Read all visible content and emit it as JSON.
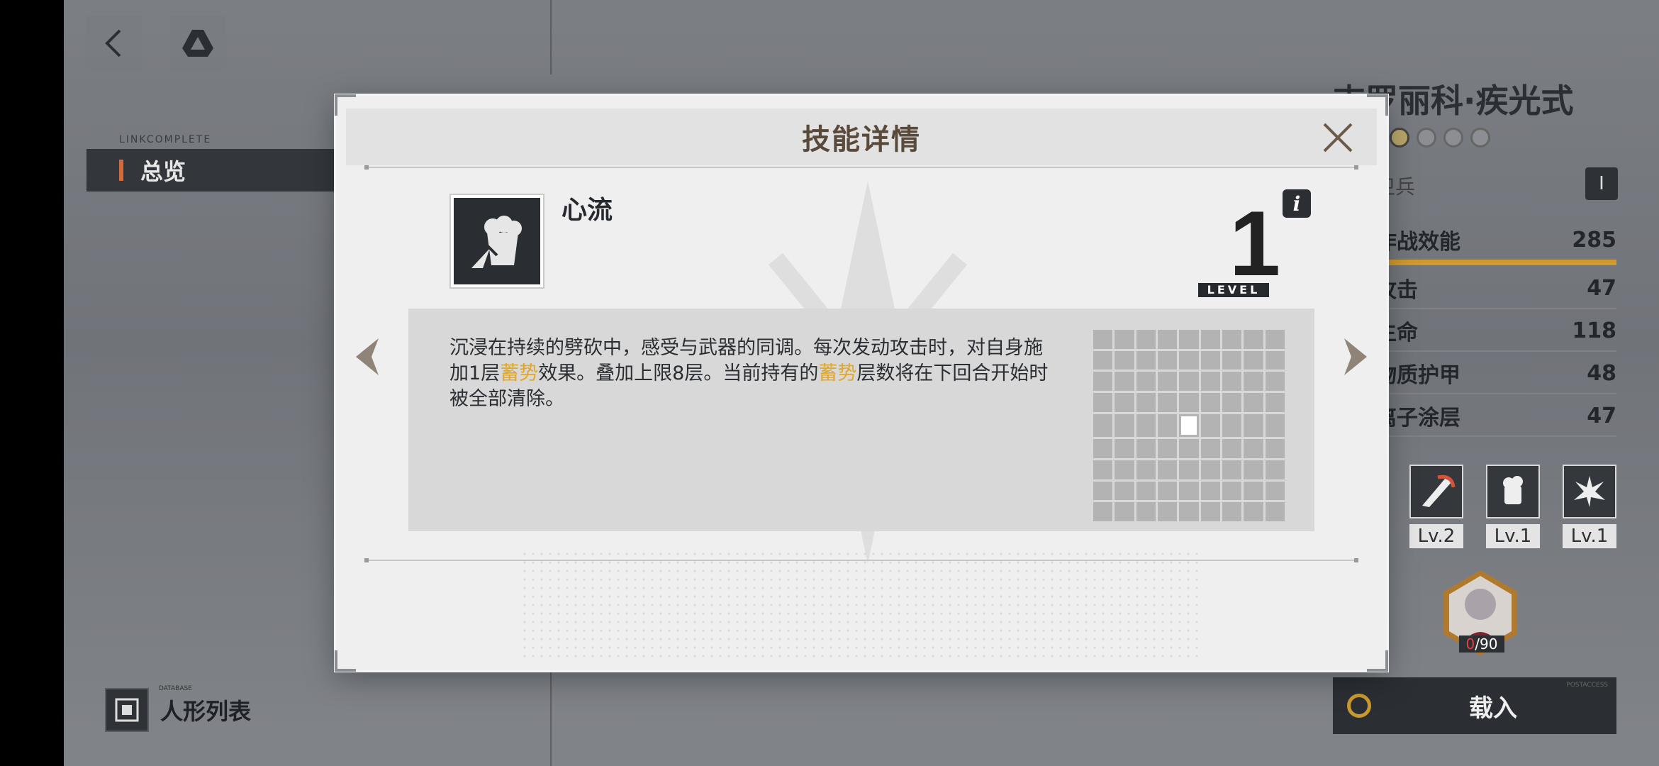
{
  "top_bar": {
    "back_icon": "chevron-left-icon",
    "drive_icon": "triangle-logo-icon"
  },
  "left_panel": {
    "link_label": "LINKCOMPLETE",
    "overview_label": "总览"
  },
  "bottom_left": {
    "dolls_list_label": "人形列表",
    "dolls_list_sub": "DATABASE"
  },
  "character": {
    "name": "吉罗丽科·疾光式",
    "role": "卫兵",
    "role_badge": "I",
    "stats": [
      {
        "label": "作战效能",
        "value": "285"
      },
      {
        "label": "攻击",
        "value": "47"
      },
      {
        "label": "生命",
        "value": "118"
      },
      {
        "label": "物质护甲",
        "value": "48"
      },
      {
        "label": "离子涂层",
        "value": "47"
      }
    ],
    "skills": [
      {
        "level": "Lv.2",
        "icon": "blade-strike-icon"
      },
      {
        "level": "Lv.1",
        "icon": "fist-icon"
      },
      {
        "level": "Lv.1",
        "icon": "burst-icon"
      }
    ],
    "avatar_count": "0",
    "avatar_max": "/90",
    "load_label": "载入",
    "load_sub": "POSTACCESS"
  },
  "modal": {
    "title": "技能详情",
    "skill_name": "心流",
    "level": "1",
    "level_label": "LEVEL",
    "info_label": "i",
    "desc_part1": "沉浸在持续的劈砍中，感受与武器的同调。每次发动攻击时，对自身施加1层",
    "desc_hl1": "蓄势",
    "desc_part2": "效果。叠加上限8层。当前持有的",
    "desc_hl2": "蓄势",
    "desc_part3": "层数将在下回合开始时被全部清除。",
    "highlight_color": "#e0a72f",
    "range_grid": {
      "rows": 9,
      "cols": 9,
      "active_cell": [
        4,
        4
      ]
    }
  }
}
